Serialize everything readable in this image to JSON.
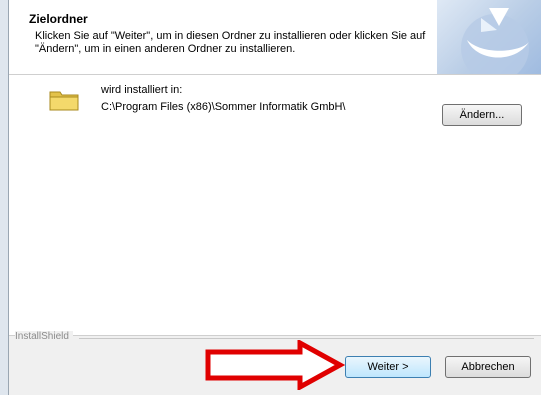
{
  "header": {
    "title": "Zielordner",
    "description": "Klicken Sie auf \"Weiter\", um in diesen Ordner zu installieren oder klicken Sie auf \"Ändern\", um in einen anderen Ordner zu installieren."
  },
  "content": {
    "install_label": "wird installiert in:",
    "install_path": "C:\\Program Files (x86)\\Sommer Informatik GmbH\\",
    "change_button": "Ändern..."
  },
  "footer": {
    "brand": "InstallShield",
    "next_button": "Weiter >",
    "cancel_button": "Abbrechen"
  },
  "colors": {
    "arrow": "#e00000",
    "next_button_border": "#3c7fb1"
  }
}
